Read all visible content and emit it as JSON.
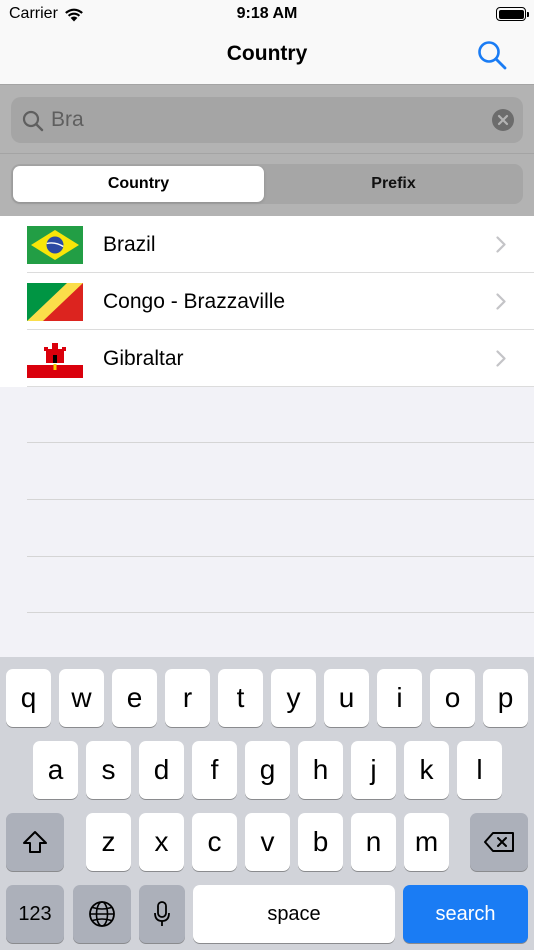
{
  "status_bar": {
    "carrier": "Carrier",
    "time": "9:18 AM",
    "wifi_icon": "wifi-icon",
    "battery_icon": "battery-icon"
  },
  "nav": {
    "title": "Country",
    "search_icon": "search-icon",
    "accent_color": "#1a7cf4"
  },
  "search": {
    "value": "Bra",
    "placeholder": "Search",
    "clear_icon": "clear-icon"
  },
  "segments": [
    {
      "label": "Country",
      "selected": true
    },
    {
      "label": "Prefix",
      "selected": false
    }
  ],
  "results": [
    {
      "name": "Brazil",
      "flag": "brazil-flag"
    },
    {
      "name": "Congo - Brazzaville",
      "flag": "congo-brazzaville-flag"
    },
    {
      "name": "Gibraltar",
      "flag": "gibraltar-flag"
    }
  ],
  "keyboard": {
    "row1": [
      "q",
      "w",
      "e",
      "r",
      "t",
      "y",
      "u",
      "i",
      "o",
      "p"
    ],
    "row2": [
      "a",
      "s",
      "d",
      "f",
      "g",
      "h",
      "j",
      "k",
      "l"
    ],
    "row3": [
      "z",
      "x",
      "c",
      "v",
      "b",
      "n",
      "m"
    ],
    "numbers_label": "123",
    "space_label": "space",
    "search_label": "search"
  }
}
